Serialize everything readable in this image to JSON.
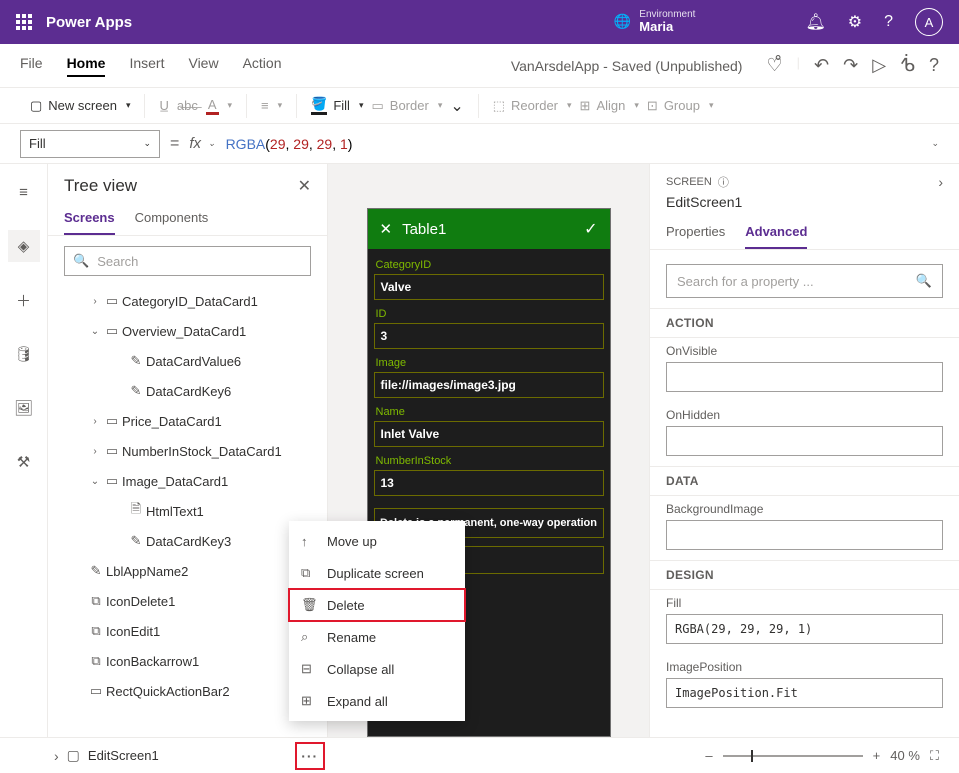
{
  "header": {
    "brand": "Power Apps",
    "environment_label": "Environment",
    "environment_name": "Maria",
    "avatar": "A"
  },
  "menubar": {
    "items": [
      "File",
      "Home",
      "Insert",
      "View",
      "Action"
    ],
    "active": "Home",
    "doc_title": "VanArsdelApp - Saved (Unpublished)"
  },
  "toolbar": {
    "new_screen": "New screen",
    "fill": "Fill",
    "border": "Border",
    "reorder": "Reorder",
    "align": "Align",
    "group": "Group"
  },
  "formula": {
    "property": "Fill",
    "value_fn": "RGBA",
    "nums": [
      "29",
      "29",
      "29",
      "1"
    ]
  },
  "tree": {
    "title": "Tree view",
    "tabs": [
      "Screens",
      "Components"
    ],
    "search_placeholder": "Search",
    "rows": [
      {
        "indent": "pl1",
        "chev": "›",
        "ico": "▭",
        "label": "CategoryID_DataCard1"
      },
      {
        "indent": "pl1",
        "chev": "⌄",
        "ico": "▭",
        "label": "Overview_DataCard1"
      },
      {
        "indent": "pl2",
        "chev": "",
        "ico": "✎",
        "label": "DataCardValue6"
      },
      {
        "indent": "pl2",
        "chev": "",
        "ico": "✎",
        "label": "DataCardKey6"
      },
      {
        "indent": "pl1",
        "chev": "›",
        "ico": "▭",
        "label": "Price_DataCard1"
      },
      {
        "indent": "pl1",
        "chev": "›",
        "ico": "▭",
        "label": "NumberInStock_DataCard1"
      },
      {
        "indent": "pl1",
        "chev": "⌄",
        "ico": "▭",
        "label": "Image_DataCard1"
      },
      {
        "indent": "pl2",
        "chev": "",
        "ico": "🗎",
        "label": "HtmlText1"
      },
      {
        "indent": "pl2",
        "chev": "",
        "ico": "✎",
        "label": "DataCardKey3"
      },
      {
        "indent": "plr",
        "chev": "",
        "ico": "✎",
        "label": "LblAppName2"
      },
      {
        "indent": "plr",
        "chev": "",
        "ico": "⧉",
        "label": "IconDelete1"
      },
      {
        "indent": "plr",
        "chev": "",
        "ico": "⧉",
        "label": "IconEdit1"
      },
      {
        "indent": "plr",
        "chev": "",
        "ico": "⧉",
        "label": "IconBackarrow1"
      },
      {
        "indent": "plr",
        "chev": "",
        "ico": "▭",
        "label": "RectQuickActionBar2"
      }
    ]
  },
  "bottom": {
    "crumb": "EditScreen1",
    "zoom": "40  %"
  },
  "canvas": {
    "app_title": "Table1",
    "fields": [
      {
        "label": "CategoryID",
        "value": "Valve"
      },
      {
        "label": "ID",
        "value": "3"
      },
      {
        "label": "Image",
        "value": "file://images/image3.jpg"
      },
      {
        "label": "Name",
        "value": "Inlet Valve"
      },
      {
        "label": "NumberInStock",
        "value": "13"
      }
    ],
    "button": "Delete is a permanent, one-way operation"
  },
  "context_menu": [
    {
      "icon": "↑",
      "label": "Move up"
    },
    {
      "icon": "⧉",
      "label": "Duplicate screen"
    },
    {
      "icon": "🗑",
      "label": "Delete",
      "highlight": true
    },
    {
      "icon": "⌕",
      "label": "Rename"
    },
    {
      "icon": "⊟",
      "label": "Collapse all"
    },
    {
      "icon": "⊞",
      "label": "Expand all"
    }
  ],
  "props": {
    "screen_label": "SCREEN",
    "name": "EditScreen1",
    "tabs": [
      "Properties",
      "Advanced"
    ],
    "search_placeholder": "Search for a property ...",
    "sections": {
      "action": "ACTION",
      "data": "DATA",
      "design": "DESIGN"
    },
    "items": {
      "on_visible": "OnVisible",
      "on_hidden": "OnHidden",
      "background_image": "BackgroundImage",
      "fill": "Fill",
      "fill_value": "RGBA(29, 29, 29, 1)",
      "image_position": "ImagePosition",
      "image_position_value": "ImagePosition.Fit"
    }
  }
}
